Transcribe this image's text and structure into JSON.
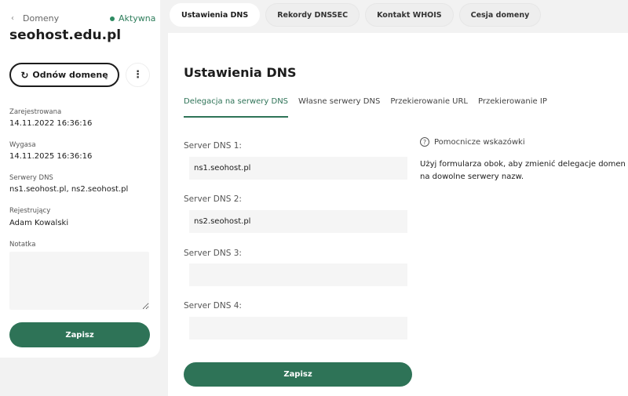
{
  "domain_panel": {
    "back_label": "Domeny",
    "status": "Aktywna",
    "domain_name": "seohost.edu.pl",
    "renew_label": "Odnów domenę",
    "fields": [
      {
        "label": "Zarejestrowana",
        "value": "14.11.2022 16:36:16"
      },
      {
        "label": "Wygasa",
        "value": "14.11.2025 16:36:16"
      },
      {
        "label": "Serwery DNS",
        "value": "ns1.seohost.pl, ns2.seohost.pl"
      },
      {
        "label": "Rejestrujący",
        "value": "Adam Kowalski"
      }
    ],
    "note_label": "Notatka",
    "note_value": "",
    "save_label": "Zapisz"
  },
  "tabs": [
    "Ustawienia DNS",
    "Rekordy DNSSEC",
    "Kontakt WHOIS",
    "Cesja domeny"
  ],
  "main": {
    "title": "Ustawienia DNS",
    "subtabs": [
      "Delegacja na serwery DNS",
      "Własne serwery DNS",
      "Przekierowanie URL",
      "Przekierowanie IP"
    ],
    "dns_servers": [
      {
        "label": "Server DNS 1:",
        "value": "ns1.seohost.pl"
      },
      {
        "label": "Server DNS 2:",
        "value": "ns2.seohost.pl"
      },
      {
        "label": "Server DNS 3:",
        "value": ""
      },
      {
        "label": "Server DNS 4:",
        "value": ""
      }
    ],
    "hint_title": "Pomocnicze wskazówki",
    "hint_text": "Użyj formularza obok, aby zmienić delegacje domen na dowolne serwery nazw.",
    "save_label": "Zapisz"
  },
  "colors": {
    "accent": "#2e7357",
    "status": "#2e8b62"
  }
}
